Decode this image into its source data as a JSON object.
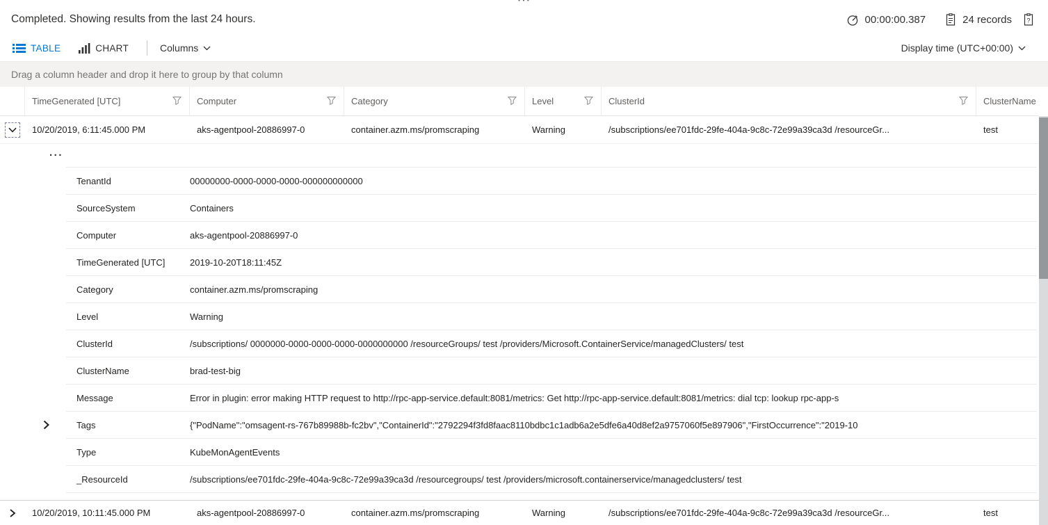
{
  "colors": {
    "accent": "#0078d4",
    "text": "#252423",
    "muted_text": "#605e5c",
    "group_bar_bg": "#f3f2f1",
    "border": "#eaeaea",
    "scrollbar_thumb": "#94989b"
  },
  "panel": {
    "resize_handle": "⋯"
  },
  "status_bar": {
    "message": "Completed. Showing results from the last 24 hours.",
    "duration": "00:00:00.387",
    "records": "24 records"
  },
  "toolbar": {
    "table_tab": "TABLE",
    "chart_tab": "CHART",
    "columns_label": "Columns",
    "display_time_label": "Display time (UTC+00:00)"
  },
  "group_bar": {
    "hint": "Drag a column header and drop it here to group by that column"
  },
  "grid": {
    "columns": [
      "TimeGenerated [UTC]",
      "Computer",
      "Category",
      "Level",
      "ClusterId",
      "ClusterName"
    ],
    "rows": [
      {
        "expanded": true,
        "cells": [
          "10/20/2019, 6:11:45.000 PM",
          "aks-agentpool-20886997-0",
          "container.azm.ms/promscraping",
          "Warning",
          "/subscriptions/ee701fdc-29fe-404a-9c8c-72e99a39ca3d /resourceGr...",
          "test"
        ]
      },
      {
        "expanded": false,
        "cells": [
          "10/20/2019, 10:11:45.000 PM",
          "aks-agentpool-20886997-0",
          "container.azm.ms/promscraping",
          "Warning",
          "/subscriptions/ee701fdc-29fe-404a-9c8c-72e99a39ca3d /resourceGr...",
          "test"
        ]
      }
    ]
  },
  "details": {
    "more_indicator": "...",
    "rows": [
      {
        "label": "TenantId",
        "value": "00000000-0000-0000-0000-000000000000"
      },
      {
        "label": "SourceSystem",
        "value": "Containers"
      },
      {
        "label": "Computer",
        "value": "aks-agentpool-20886997-0"
      },
      {
        "label": "TimeGenerated [UTC]",
        "value": "2019-10-20T18:11:45Z"
      },
      {
        "label": "Category",
        "value": "container.azm.ms/promscraping"
      },
      {
        "label": "Level",
        "value": "Warning"
      },
      {
        "label": "ClusterId",
        "value": "/subscriptions/ 0000000-0000-0000-0000-0000000000 /resourceGroups/ test /providers/Microsoft.ContainerService/managedClusters/ test"
      },
      {
        "label": "ClusterName",
        "value": "brad-test-big"
      },
      {
        "label": "Message",
        "value": "Error in plugin: error making HTTP request to http://rpc-app-service.default:8081/metrics: Get http://rpc-app-service.default:8081/metrics: dial tcp: lookup rpc-app-s"
      },
      {
        "label": "Tags",
        "value": "{\"PodName\":\"omsagent-rs-767b89988b-fc2bv\",\"ContainerId\":\"2792294f3fd8faac8110bdbc1c1adb6a2e5dfe6a40d8ef2a9757060f5e897906\",\"FirstOccurrence\":\"2019-10"
      },
      {
        "label": "Type",
        "value": "KubeMonAgentEvents"
      },
      {
        "label": "_ResourceId",
        "value": "/subscriptions/ee701fdc-29fe-404a-9c8c-72e99a39ca3d  /resourcegroups/ test /providers/microsoft.containerservice/managedclusters/ test"
      }
    ]
  },
  "icons": {
    "timer": "stopwatch-icon",
    "records": "page-icon",
    "copy_results": "clipboard-icon",
    "table": "list-icon",
    "chart": "bar-chart-icon",
    "dropdown": "chevron-down-icon",
    "filter": "funnel-icon",
    "expand": "chevron-right-icon",
    "collapse": "chevron-down-icon",
    "more": "ellipsis-icon"
  }
}
